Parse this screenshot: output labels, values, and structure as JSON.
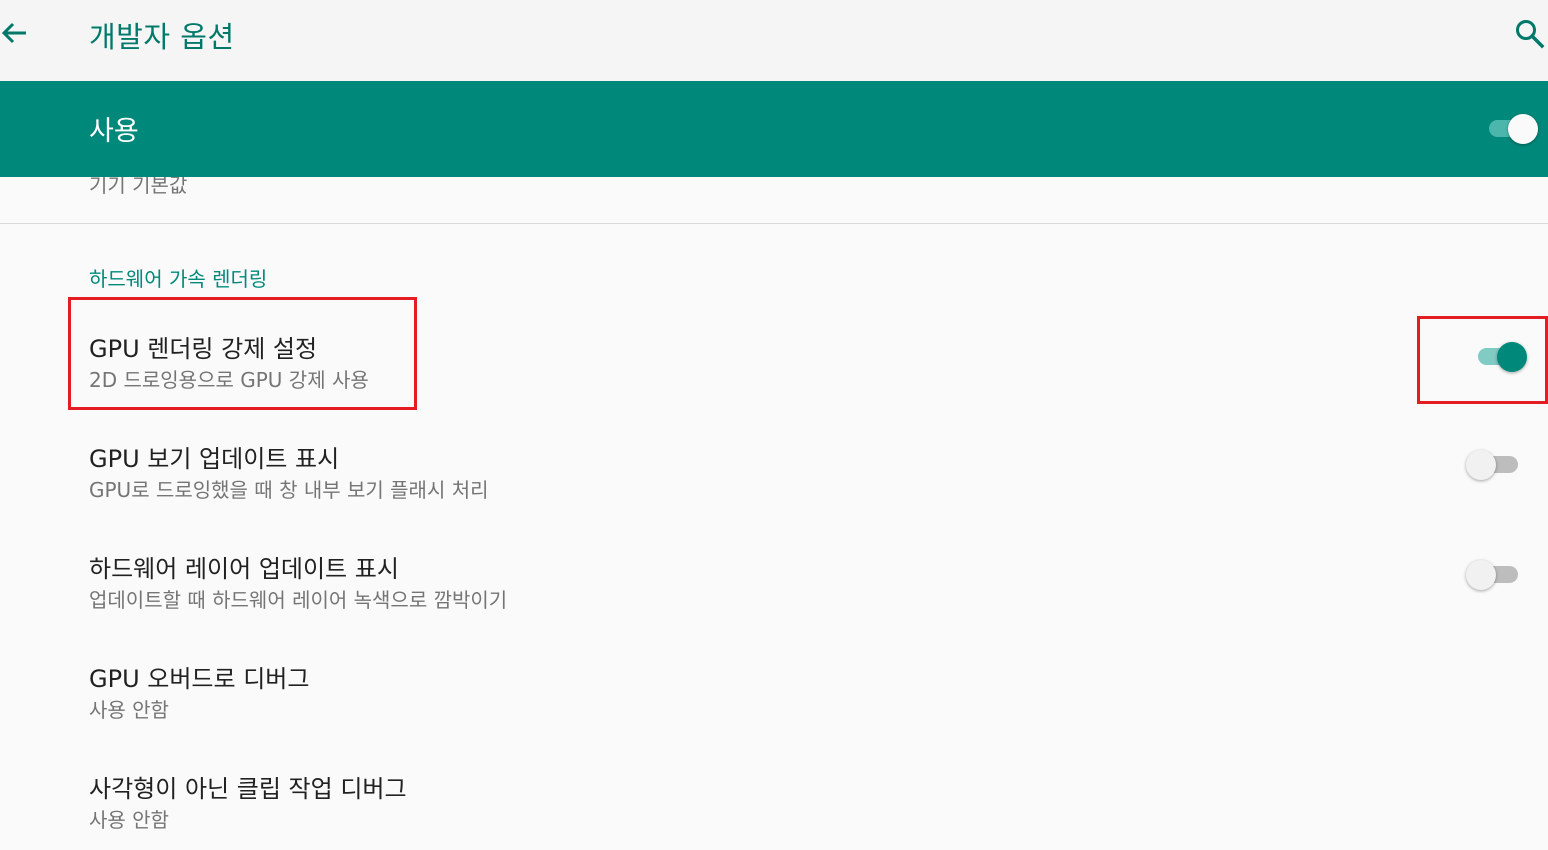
{
  "appbar": {
    "title": "개발자 옵션",
    "back_icon": "arrow-back-icon",
    "search_icon": "search-icon"
  },
  "master": {
    "label": "사용",
    "enabled": true
  },
  "partial_item": {
    "summary": "기기 기본값"
  },
  "category": {
    "title": "하드웨어 가속 렌더링"
  },
  "preferences": [
    {
      "title": "GPU 렌더링 강제 설정",
      "summary": "2D 드로잉용으로 GPU 강제 사용",
      "switch": true
    },
    {
      "title": "GPU 보기 업데이트 표시",
      "summary": "GPU로 드로잉했을 때 창 내부 보기 플래시 처리",
      "switch": false
    },
    {
      "title": "하드웨어 레이어 업데이트 표시",
      "summary": "업데이트할 때 하드웨어 레이어 녹색으로 깜박이기",
      "switch": false
    },
    {
      "title": "GPU 오버드로 디버그",
      "summary": "사용 안함"
    },
    {
      "title": "사각형이 아닌 클립 작업 디버그",
      "summary": "사용 안함"
    }
  ],
  "colors": {
    "accent": "#00897b",
    "master_bar": "#00897b",
    "highlight": "#e51c23"
  }
}
